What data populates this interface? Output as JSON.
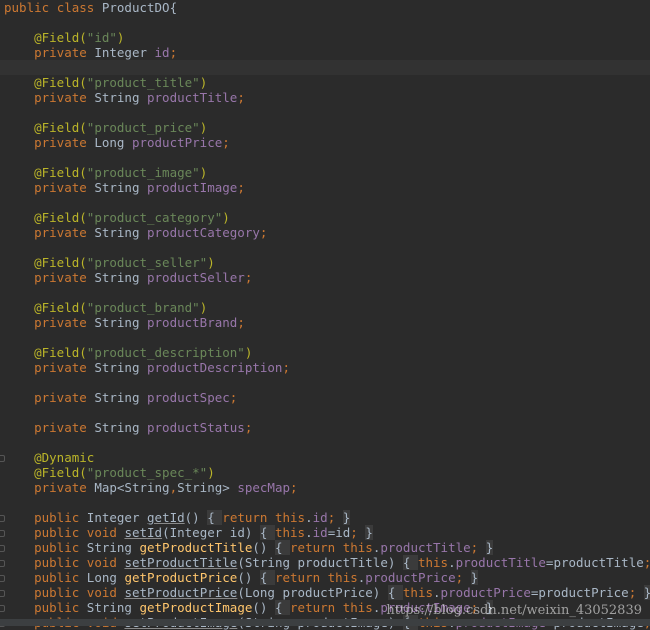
{
  "editor": {
    "lines": [
      {
        "tokens": [
          {
            "t": "public ",
            "c": "keyword"
          },
          {
            "t": "class ",
            "c": "keyword"
          },
          {
            "t": "ProductDO{",
            "c": "plain"
          }
        ]
      },
      {
        "tokens": []
      },
      {
        "tokens": [
          {
            "t": "    @Field(",
            "c": "annotation"
          },
          {
            "t": "\"id\"",
            "c": "string"
          },
          {
            "t": ")",
            "c": "annotation"
          }
        ]
      },
      {
        "tokens": [
          {
            "t": "    private ",
            "c": "keyword"
          },
          {
            "t": "Integer ",
            "c": "plain"
          },
          {
            "t": "id",
            "c": "field"
          },
          {
            "t": ";",
            "c": "punct"
          }
        ]
      },
      {
        "tokens": [],
        "current": true
      },
      {
        "tokens": [
          {
            "t": "    @Field(",
            "c": "annotation"
          },
          {
            "t": "\"product_title\"",
            "c": "string"
          },
          {
            "t": ")",
            "c": "annotation"
          }
        ]
      },
      {
        "tokens": [
          {
            "t": "    private ",
            "c": "keyword"
          },
          {
            "t": "String ",
            "c": "plain"
          },
          {
            "t": "productTitle",
            "c": "field"
          },
          {
            "t": ";",
            "c": "punct"
          }
        ]
      },
      {
        "tokens": []
      },
      {
        "tokens": [
          {
            "t": "    @Field(",
            "c": "annotation"
          },
          {
            "t": "\"product_price\"",
            "c": "string"
          },
          {
            "t": ")",
            "c": "annotation"
          }
        ]
      },
      {
        "tokens": [
          {
            "t": "    private ",
            "c": "keyword"
          },
          {
            "t": "Long ",
            "c": "plain"
          },
          {
            "t": "productPrice",
            "c": "field"
          },
          {
            "t": ";",
            "c": "punct"
          }
        ]
      },
      {
        "tokens": []
      },
      {
        "tokens": [
          {
            "t": "    @Field(",
            "c": "annotation"
          },
          {
            "t": "\"product_image\"",
            "c": "string"
          },
          {
            "t": ")",
            "c": "annotation"
          }
        ]
      },
      {
        "tokens": [
          {
            "t": "    private ",
            "c": "keyword"
          },
          {
            "t": "String ",
            "c": "plain"
          },
          {
            "t": "productImage",
            "c": "field"
          },
          {
            "t": ";",
            "c": "punct"
          }
        ]
      },
      {
        "tokens": []
      },
      {
        "tokens": [
          {
            "t": "    @Field(",
            "c": "annotation"
          },
          {
            "t": "\"product_category\"",
            "c": "string"
          },
          {
            "t": ")",
            "c": "annotation"
          }
        ]
      },
      {
        "tokens": [
          {
            "t": "    private ",
            "c": "keyword"
          },
          {
            "t": "String ",
            "c": "plain"
          },
          {
            "t": "productCategory",
            "c": "field"
          },
          {
            "t": ";",
            "c": "punct"
          }
        ]
      },
      {
        "tokens": []
      },
      {
        "tokens": [
          {
            "t": "    @Field(",
            "c": "annotation"
          },
          {
            "t": "\"product_seller\"",
            "c": "string"
          },
          {
            "t": ")",
            "c": "annotation"
          }
        ]
      },
      {
        "tokens": [
          {
            "t": "    private ",
            "c": "keyword"
          },
          {
            "t": "String ",
            "c": "plain"
          },
          {
            "t": "productSeller",
            "c": "field"
          },
          {
            "t": ";",
            "c": "punct"
          }
        ]
      },
      {
        "tokens": []
      },
      {
        "tokens": [
          {
            "t": "    @Field(",
            "c": "annotation"
          },
          {
            "t": "\"product_brand\"",
            "c": "string"
          },
          {
            "t": ")",
            "c": "annotation"
          }
        ]
      },
      {
        "tokens": [
          {
            "t": "    private ",
            "c": "keyword"
          },
          {
            "t": "String ",
            "c": "plain"
          },
          {
            "t": "productBrand",
            "c": "field"
          },
          {
            "t": ";",
            "c": "punct"
          }
        ]
      },
      {
        "tokens": []
      },
      {
        "tokens": [
          {
            "t": "    @Field(",
            "c": "annotation"
          },
          {
            "t": "\"product_description\"",
            "c": "string"
          },
          {
            "t": ")",
            "c": "annotation"
          }
        ]
      },
      {
        "tokens": [
          {
            "t": "    private ",
            "c": "keyword"
          },
          {
            "t": "String ",
            "c": "plain"
          },
          {
            "t": "productDescription",
            "c": "field"
          },
          {
            "t": ";",
            "c": "punct"
          }
        ]
      },
      {
        "tokens": []
      },
      {
        "tokens": [
          {
            "t": "    private ",
            "c": "keyword"
          },
          {
            "t": "String ",
            "c": "plain"
          },
          {
            "t": "productSpec",
            "c": "field"
          },
          {
            "t": ";",
            "c": "punct"
          }
        ]
      },
      {
        "tokens": []
      },
      {
        "tokens": [
          {
            "t": "    private ",
            "c": "keyword"
          },
          {
            "t": "String ",
            "c": "plain"
          },
          {
            "t": "productStatus",
            "c": "field"
          },
          {
            "t": ";",
            "c": "punct"
          }
        ]
      },
      {
        "tokens": []
      },
      {
        "tokens": [
          {
            "t": "    @Dynamic",
            "c": "annotation"
          }
        ],
        "fold": true
      },
      {
        "tokens": [
          {
            "t": "    @Field(",
            "c": "annotation"
          },
          {
            "t": "\"product_spec_*\"",
            "c": "string"
          },
          {
            "t": ")",
            "c": "annotation"
          }
        ]
      },
      {
        "tokens": [
          {
            "t": "    private ",
            "c": "keyword"
          },
          {
            "t": "Map<String",
            "c": "plain"
          },
          {
            "t": ",",
            "c": "punct"
          },
          {
            "t": "String> ",
            "c": "plain"
          },
          {
            "t": "specMap",
            "c": "field"
          },
          {
            "t": ";",
            "c": "punct"
          }
        ]
      },
      {
        "tokens": []
      },
      {
        "tokens": [
          {
            "t": "    public ",
            "c": "keyword"
          },
          {
            "t": "Integer ",
            "c": "plain"
          },
          {
            "t": "getId",
            "c": "deprecated"
          },
          {
            "t": "() ",
            "c": "plain"
          },
          {
            "t": "{ ",
            "c": "brace"
          },
          {
            "t": "return ",
            "c": "keyword"
          },
          {
            "t": "this",
            "c": "keyword"
          },
          {
            "t": ".",
            "c": "plain"
          },
          {
            "t": "id",
            "c": "field"
          },
          {
            "t": "; ",
            "c": "punct"
          },
          {
            "t": "}",
            "c": "brace"
          }
        ],
        "fold": true
      },
      {
        "tokens": [
          {
            "t": "    public ",
            "c": "keyword"
          },
          {
            "t": "void ",
            "c": "keyword"
          },
          {
            "t": "setId",
            "c": "deprecated"
          },
          {
            "t": "(Integer id) ",
            "c": "plain"
          },
          {
            "t": "{ ",
            "c": "brace"
          },
          {
            "t": "this",
            "c": "keyword"
          },
          {
            "t": ".",
            "c": "plain"
          },
          {
            "t": "id",
            "c": "field"
          },
          {
            "t": "=id",
            "c": "plain"
          },
          {
            "t": "; ",
            "c": "punct"
          },
          {
            "t": "}",
            "c": "brace"
          }
        ],
        "fold": true
      },
      {
        "tokens": [
          {
            "t": "    public ",
            "c": "keyword"
          },
          {
            "t": "String ",
            "c": "plain"
          },
          {
            "t": "getProductTitle",
            "c": "method"
          },
          {
            "t": "() ",
            "c": "plain"
          },
          {
            "t": "{ ",
            "c": "brace"
          },
          {
            "t": "return ",
            "c": "keyword"
          },
          {
            "t": "this",
            "c": "keyword"
          },
          {
            "t": ".",
            "c": "plain"
          },
          {
            "t": "productTitle",
            "c": "field"
          },
          {
            "t": "; ",
            "c": "punct"
          },
          {
            "t": "}",
            "c": "brace"
          }
        ],
        "fold": true
      },
      {
        "tokens": [
          {
            "t": "    public ",
            "c": "keyword"
          },
          {
            "t": "void ",
            "c": "keyword"
          },
          {
            "t": "setProductTitle",
            "c": "deprecated"
          },
          {
            "t": "(String productTitle) ",
            "c": "plain"
          },
          {
            "t": "{ ",
            "c": "brace"
          },
          {
            "t": "this",
            "c": "keyword"
          },
          {
            "t": ".",
            "c": "plain"
          },
          {
            "t": "productTitle",
            "c": "field"
          },
          {
            "t": "=productTitle",
            "c": "plain"
          },
          {
            "t": "; ",
            "c": "punct"
          },
          {
            "t": "}",
            "c": "brace"
          }
        ],
        "fold": true
      },
      {
        "tokens": [
          {
            "t": "    public ",
            "c": "keyword"
          },
          {
            "t": "Long ",
            "c": "plain"
          },
          {
            "t": "getProductPrice",
            "c": "method"
          },
          {
            "t": "() ",
            "c": "plain"
          },
          {
            "t": "{ ",
            "c": "brace"
          },
          {
            "t": "return ",
            "c": "keyword"
          },
          {
            "t": "this",
            "c": "keyword"
          },
          {
            "t": ".",
            "c": "plain"
          },
          {
            "t": "productPrice",
            "c": "field"
          },
          {
            "t": "; ",
            "c": "punct"
          },
          {
            "t": "}",
            "c": "brace"
          }
        ],
        "fold": true
      },
      {
        "tokens": [
          {
            "t": "    public ",
            "c": "keyword"
          },
          {
            "t": "void ",
            "c": "keyword"
          },
          {
            "t": "setProductPrice",
            "c": "deprecated"
          },
          {
            "t": "(Long productPrice) ",
            "c": "plain"
          },
          {
            "t": "{ ",
            "c": "brace"
          },
          {
            "t": "this",
            "c": "keyword"
          },
          {
            "t": ".",
            "c": "plain"
          },
          {
            "t": "productPrice",
            "c": "field"
          },
          {
            "t": "=productPrice",
            "c": "plain"
          },
          {
            "t": "; ",
            "c": "punct"
          },
          {
            "t": "}",
            "c": "brace"
          }
        ],
        "fold": true
      },
      {
        "tokens": [
          {
            "t": "    public ",
            "c": "keyword"
          },
          {
            "t": "String ",
            "c": "plain"
          },
          {
            "t": "getProductImage",
            "c": "method"
          },
          {
            "t": "() ",
            "c": "plain"
          },
          {
            "t": "{ ",
            "c": "brace"
          },
          {
            "t": "return ",
            "c": "keyword"
          },
          {
            "t": "this",
            "c": "keyword"
          },
          {
            "t": ".",
            "c": "plain"
          },
          {
            "t": "productImage",
            "c": "field"
          },
          {
            "t": "; ",
            "c": "punct"
          },
          {
            "t": "}",
            "c": "brace"
          }
        ],
        "fold": true
      },
      {
        "tokens": [
          {
            "t": "    public ",
            "c": "keyword"
          },
          {
            "t": "void ",
            "c": "keyword"
          },
          {
            "t": "setProductImage",
            "c": "deprecated"
          },
          {
            "t": "(String productImage) ",
            "c": "plain"
          },
          {
            "t": "{ ",
            "c": "brace"
          },
          {
            "t": "this",
            "c": "keyword"
          },
          {
            "t": ".",
            "c": "plain"
          },
          {
            "t": "productImage",
            "c": "field"
          },
          {
            "t": "=productImage",
            "c": "plain"
          },
          {
            "t": ";",
            "c": "punct"
          }
        ],
        "fold": true
      }
    ]
  },
  "watermark": "https://blog.csdn.net/weixin_43052839"
}
